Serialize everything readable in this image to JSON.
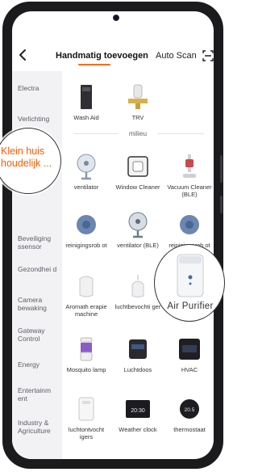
{
  "header": {
    "back_icon": "chevron-left-icon",
    "tab_manual": "Handmatig toevoegen",
    "tab_auto": "Auto Scan",
    "scan_icon": "scan-frame-icon",
    "accent": "#ff6a1a"
  },
  "sidebar": {
    "items": [
      {
        "label": "Electra"
      },
      {
        "label": "Verlichting"
      },
      {
        "label": "Beveiliging ssensor"
      },
      {
        "label": "Gezondhei d"
      },
      {
        "label": "Camera bewaking"
      },
      {
        "label": "Gateway Control"
      },
      {
        "label": "Energy"
      },
      {
        "label": "Entertainm ent"
      },
      {
        "label": "Industry & Agriculture"
      }
    ]
  },
  "content": {
    "top_row": [
      {
        "label": "Wash Aid",
        "icon": "wash-aid-icon"
      },
      {
        "label": "TRV",
        "icon": "trv-valve-icon"
      }
    ],
    "section_title": "milieu",
    "grid": [
      {
        "label": "ventilator",
        "icon": "fan-icon"
      },
      {
        "label": "Window Cleaner",
        "icon": "window-cleaner-icon"
      },
      {
        "label": "Vacuum Cleaner (BLE)",
        "icon": "vacuum-cleaner-icon"
      },
      {
        "label": "reinigingsrob ot",
        "icon": "robot-vacuum-icon"
      },
      {
        "label": "ventilator (BLE)",
        "icon": "fan-icon"
      },
      {
        "label": "reinigingsrob ot",
        "icon": "robot-vacuum-icon"
      },
      {
        "label": "Aromath erapie machine",
        "icon": "aroma-diffuser-icon"
      },
      {
        "label": "luchtbevochti ger",
        "icon": "humidifier-icon"
      },
      {
        "label": "",
        "icon": "air-purifier-icon"
      },
      {
        "label": "Mosquito lamp",
        "icon": "mosquito-lamp-icon"
      },
      {
        "label": "Luchtdoos",
        "icon": "air-box-icon"
      },
      {
        "label": "HVAC",
        "icon": "hvac-panel-icon"
      },
      {
        "label": "luchtontvocht igers",
        "icon": "dehumidifier-icon"
      },
      {
        "label": "Weather clock",
        "icon": "weather-clock-icon"
      },
      {
        "label": "thermostaat",
        "icon": "thermostat-icon"
      }
    ],
    "weather_clock_time": "20:30",
    "thermostat_value": "20.5"
  },
  "callouts": {
    "left": "Klein huis houdelijk ...",
    "right": "Air Purifier"
  }
}
